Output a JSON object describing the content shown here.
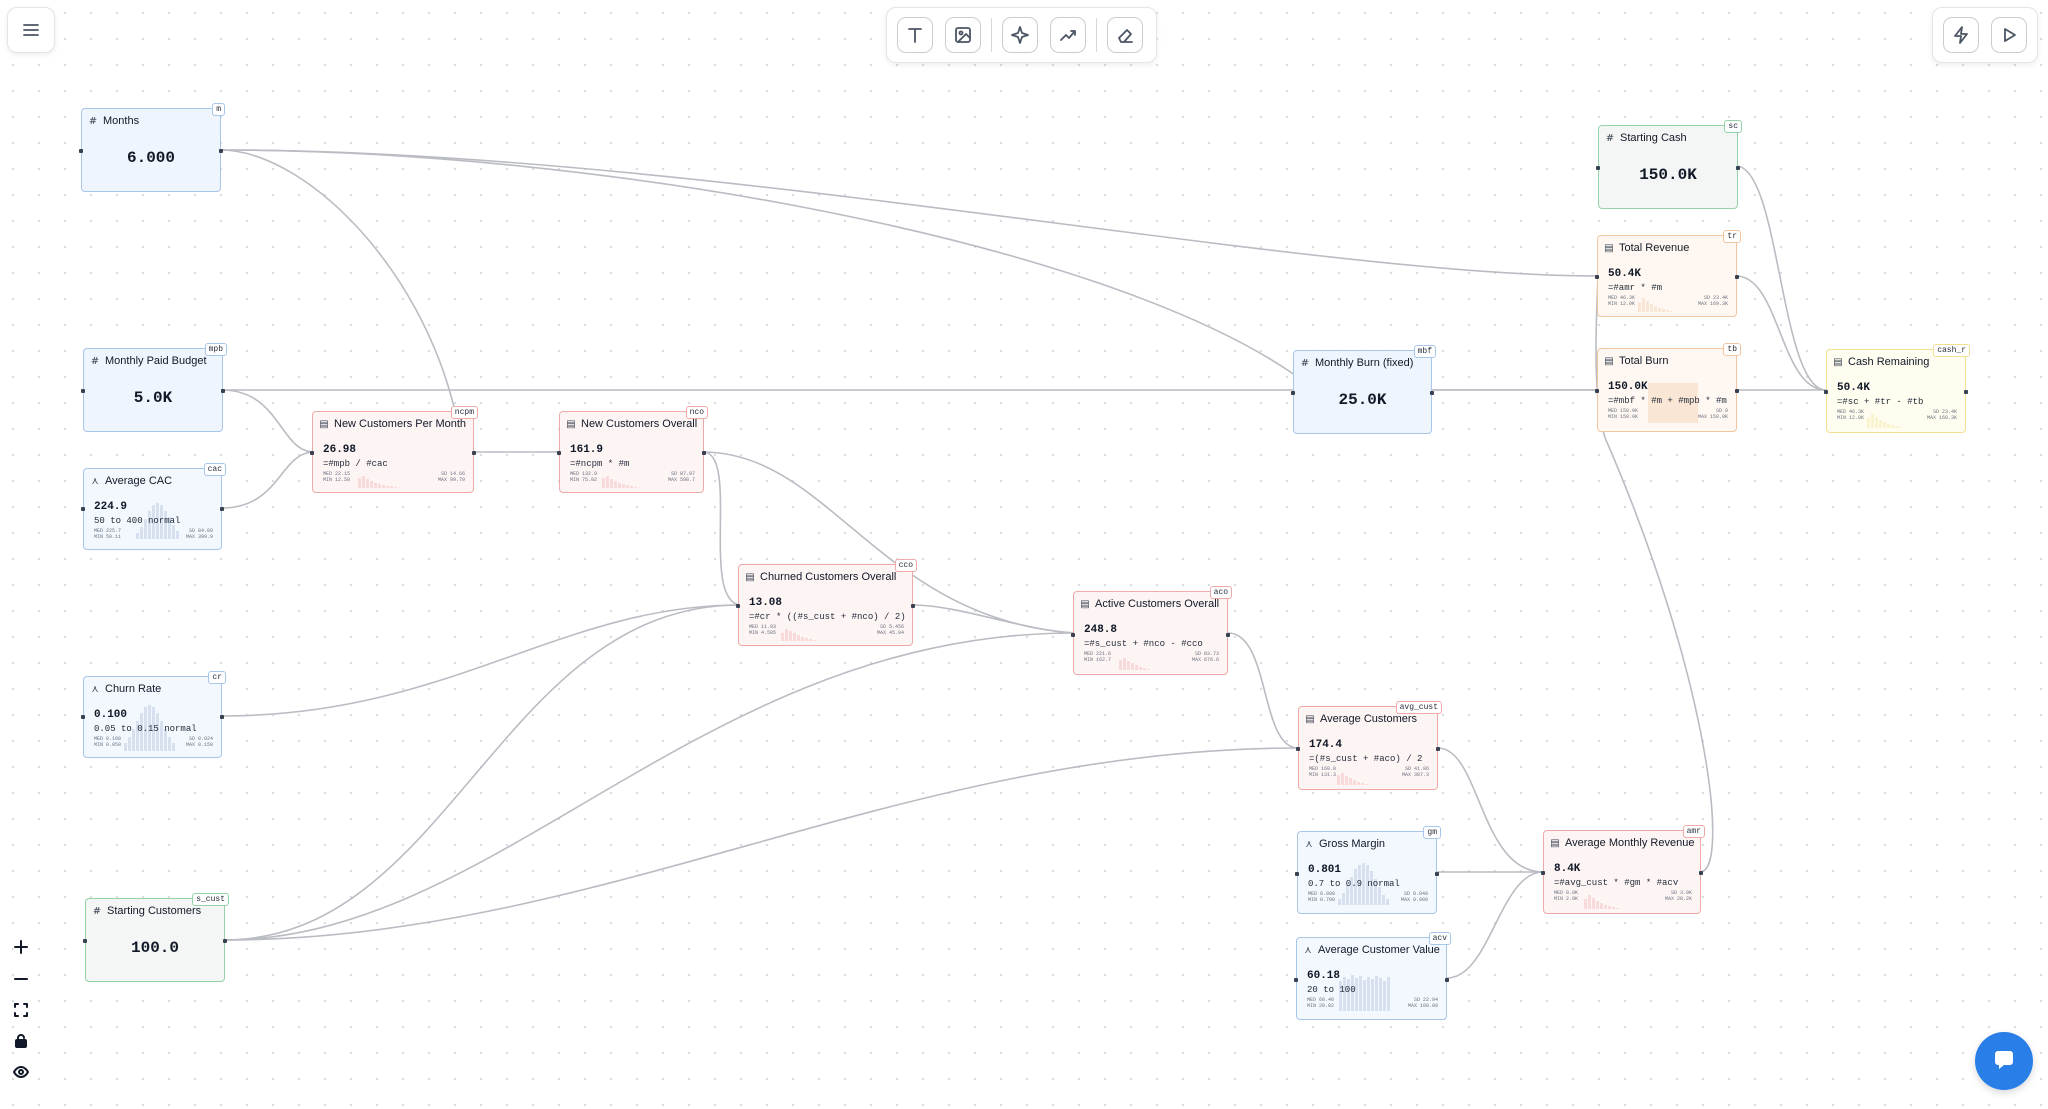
{
  "nodes": {
    "months": {
      "title": "Months",
      "badge": "m",
      "value": "6.000"
    },
    "mpb": {
      "title": "Monthly Paid Budget",
      "badge": "mpb",
      "value": "5.0K"
    },
    "cac": {
      "title": "Average CAC",
      "badge": "cac",
      "value": "224.9",
      "formula": "50 to 400 normal",
      "stat_l1": "MED 225.7",
      "stat_l2": "MIN 50.11",
      "stat_r1": "SD 84.09",
      "stat_r2": "MAX 399.9"
    },
    "cr": {
      "title": "Churn Rate",
      "badge": "cr",
      "value": "0.100",
      "formula": "0.05 to 0.15 normal",
      "stat_l1": "MED 0.100",
      "stat_l2": "MIN 0.050",
      "stat_r1": "SD 0.024",
      "stat_r2": "MAX 0.150"
    },
    "s_cust": {
      "title": "Starting Customers",
      "badge": "s_cust",
      "value": "100.0"
    },
    "ncpm": {
      "title": "New Customers Per Month",
      "badge": "ncpm",
      "value": "26.98",
      "formula": "=#mpb / #cac",
      "stat_l1": "MED 22.15",
      "stat_l2": "MIN 12.50",
      "stat_r1": "SD 14.66",
      "stat_r2": "MAX 99.79"
    },
    "nco": {
      "title": "New Customers Overall",
      "badge": "nco",
      "value": "161.9",
      "formula": "=#ncpm * #m",
      "stat_l1": "MED 132.9",
      "stat_l2": "MIN 75.02",
      "stat_r1": "SD 87.97",
      "stat_r2": "MAX 598.7"
    },
    "cco": {
      "title": "Churned Customers Overall",
      "badge": "cco",
      "value": "13.08",
      "formula": "=#cr * ((#s_cust + #nco) / 2)",
      "stat_l1": "MED 11.93",
      "stat_l2": "MIN 4.505",
      "stat_r1": "SD 5.456",
      "stat_r2": "MAX 45.04"
    },
    "aco": {
      "title": "Active Customers Overall",
      "badge": "aco",
      "value": "248.8",
      "formula": "=#s_cust + #nco - #cco",
      "stat_l1": "MED 221.6",
      "stat_l2": "MIN 162.7",
      "stat_r1": "SD 83.73",
      "stat_r2": "MAX 676.6"
    },
    "avg_cust": {
      "title": "Average Customers",
      "badge": "avg_cust",
      "value": "174.4",
      "formula": "=(#s_cust + #aco) / 2",
      "stat_l1": "MED 160.8",
      "stat_l2": "MIN 131.3",
      "stat_r1": "SD 41.86",
      "stat_r2": "MAX 387.3"
    },
    "gm": {
      "title": "Gross Margin",
      "badge": "gm",
      "value": "0.801",
      "formula": "0.7 to 0.9 normal",
      "stat_l1": "MED 0.800",
      "stat_l2": "MIN 0.700",
      "stat_r1": "SD 0.048",
      "stat_r2": "MAX 0.900"
    },
    "acv": {
      "title": "Average Customer Value",
      "badge": "acv",
      "value": "60.18",
      "formula": "20 to 100",
      "stat_l1": "MED 60.40",
      "stat_l2": "MIN 20.02",
      "stat_r1": "SD 22.94",
      "stat_r2": "MAX 100.00"
    },
    "mbf": {
      "title": "Monthly Burn (fixed)",
      "badge": "mbf",
      "value": "25.0K"
    },
    "sc": {
      "title": "Starting Cash",
      "badge": "sc",
      "value": "150.0K"
    },
    "tr": {
      "title": "Total Revenue",
      "badge": "tr",
      "value": "50.4K",
      "formula": "=#amr * #m",
      "stat_l1": "MED 46.3K",
      "stat_l2": "MIN 12.0K",
      "stat_r1": "SD 23.4K",
      "stat_r2": "MAX 169.3K"
    },
    "tb": {
      "title": "Total Burn",
      "badge": "tb",
      "value": "150.0K",
      "formula": "=#mbf * #m + #mpb * #m",
      "stat_l1": "MED 150.0K",
      "stat_l2": "MIN 150.0K",
      "stat_r1": "SD 0",
      "stat_r2": "MAX 150.0K"
    },
    "cash_r": {
      "title": "Cash Remaining",
      "badge": "cash_r",
      "value": "50.4K",
      "formula": "=#sc + #tr - #tb",
      "stat_l1": "MED 46.3K",
      "stat_l2": "MIN 12.0K",
      "stat_r1": "SD 23.4K",
      "stat_r2": "MAX 169.3K"
    },
    "amr": {
      "title": "Average Monthly Revenue",
      "badge": "amr",
      "value": "8.4K",
      "formula": "=#avg_cust * #gm * #acv",
      "stat_l1": "MED 8.0K",
      "stat_l2": "MIN 2.0K",
      "stat_r1": "SD 3.9K",
      "stat_r2": "MAX 28.2K"
    }
  },
  "toolbar": {
    "tools": [
      "text-tool",
      "image-tool",
      "ai-sparkle-tool",
      "connect-tool",
      "eraser-tool"
    ],
    "right_tools": [
      "lightning-tool",
      "run-tool"
    ]
  },
  "left_controls": [
    "zoom-in",
    "zoom-out",
    "fit-view",
    "lock",
    "visibility"
  ],
  "colors": {
    "input_blue": "#a8c5ea",
    "formula_red": "#eeaaa8",
    "output_orange": "#f1c59f",
    "result_yellow": "#f0df95",
    "const_green": "#94d3a7",
    "chat_button": "#2a7ee8"
  }
}
